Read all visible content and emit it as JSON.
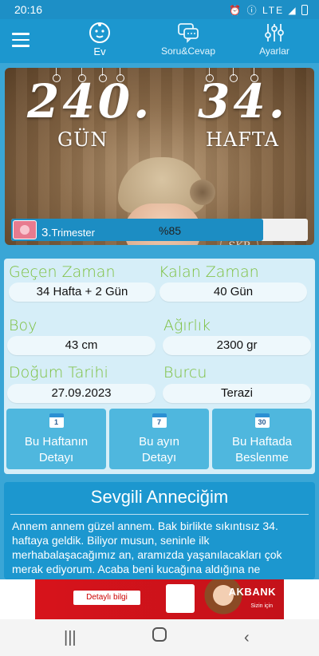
{
  "status_bar": {
    "time": "20:16",
    "indicators": "⏰ ⓘ LTE ◢"
  },
  "nav": {
    "home_label": "Ev",
    "qa_label": "Soru&Cevap",
    "settings_label": "Ayarlar"
  },
  "hero": {
    "days_value": "240.",
    "days_label": "GÜN",
    "weeks_value": "34.",
    "weeks_label": "HAFTA",
    "photo_logo": "SKP"
  },
  "trimester": {
    "number": "3.",
    "label": "Trimester",
    "percent_text": "%85",
    "progress": 0.85
  },
  "info": {
    "elapsed_title": "Geçen Zaman",
    "elapsed_value": "34 Hafta + 2 Gün",
    "remaining_title": "Kalan Zaman",
    "remaining_value": "40 Gün",
    "height_title": "Boy",
    "height_value": "43 cm",
    "weight_title": "Ağırlık",
    "weight_value": "2300 gr",
    "due_title": "Doğum Tarihi",
    "due_value": "27.09.2023",
    "sign_title": "Burcu",
    "sign_value": "Terazi"
  },
  "tiles": [
    {
      "icon_day": "1",
      "line1": "Bu Haftanın",
      "line2": "Detayı"
    },
    {
      "icon_day": "7",
      "line1": "Bu ayın",
      "line2": "Detayı"
    },
    {
      "icon_day": "30",
      "line1": "Bu Haftada",
      "line2": "Beslenme"
    }
  ],
  "message": {
    "title": "Sevgili Anneciğim",
    "body": "Annem annem güzel annem. Bak birlikte sıkıntısız 34. haftaya geldik. Biliyor musun, seninle ilk merhabalaşacağımız an, aramızda yaşanılacakları çok merak ediyorum. Acaba beni kucağına aldığına ne hissedeceksin? Diğer bebeklerden korktuğun gibi"
  },
  "ad": {
    "cta": "Detaylı bilgi",
    "brand": "AKBANK",
    "slogan": "Sizin için"
  },
  "colors": {
    "primary": "#1c97cf",
    "accent_green": "#7bbf3c",
    "panel": "#d6eef8"
  },
  "icons": [
    "menu-icon",
    "baby-icon",
    "chat-icon",
    "sliders-icon",
    "calendar-icon",
    "uterus-icon"
  ]
}
